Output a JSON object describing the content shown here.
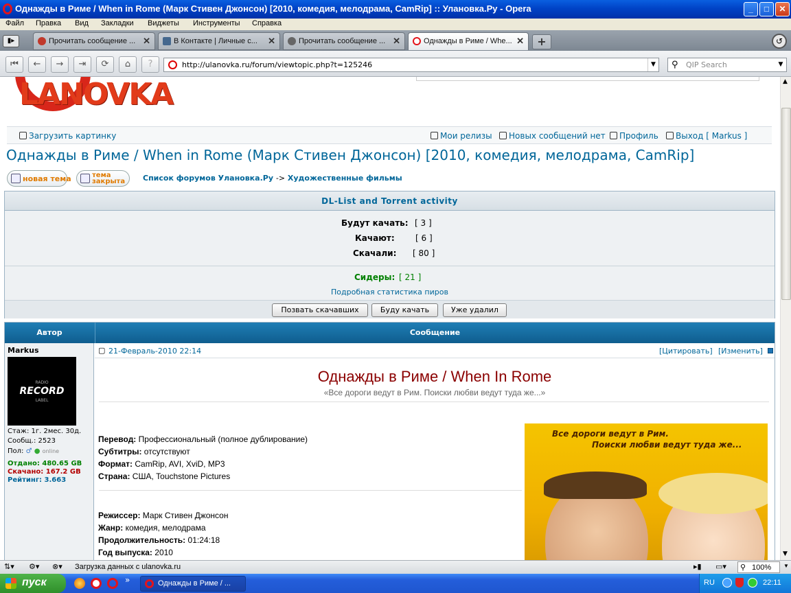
{
  "window": {
    "title": "Однажды в Риме / When in Rome (Марк Стивен Джонсон) [2010, комедия, мелодрама, CamRip] :: Улановка.Ру - Opera",
    "buttons": {
      "minimize": "_",
      "maximize": "□",
      "close": "✕"
    }
  },
  "menu": [
    "Файл",
    "Правка",
    "Вид",
    "Закладки",
    "Виджеты",
    "Инструменты",
    "Справка"
  ],
  "tabs": [
    {
      "label": "Прочитать сообщение ...",
      "favicon_color": "#c0392b"
    },
    {
      "label": "В Контакте | Личные с...",
      "favicon_color": "#45688e"
    },
    {
      "label": "Прочитать сообщение ...",
      "favicon_color": "#666666"
    },
    {
      "label": "Однажды в Риме / Whe...",
      "favicon_color": "#e3141b",
      "active": true
    }
  ],
  "nav": {
    "url": "http://ulanovka.ru/forum/viewtopic.php?t=125246",
    "search_placeholder": "QIP Search"
  },
  "site": {
    "logo": "LANOVKA",
    "toplinks": {
      "upload": "Загрузить картинку",
      "releases": "Мои релизы",
      "new_msgs": "Новых сообщений нет",
      "profile": "Профиль",
      "logout": "Выход [ Markus ]"
    },
    "topic_title": "Однажды в Риме / When in Rome (Марк Стивен Джонсон) [2010, комедия, мелодрама, CamRip]",
    "new_topic": "новая тема",
    "topic_closed": "тема закрыта",
    "breadcrumb": {
      "forums": "Список форумов Улановка.Ру",
      "sep": "->",
      "section": "Художественные фильмы"
    }
  },
  "dl": {
    "header": "DL-List and Torrent activity",
    "will_download_label": "Будут качать:",
    "will_download": "[ 3 ]",
    "downloading_label": "Качают:",
    "downloading": "[ 6 ]",
    "downloaded_label": "Скачали:",
    "downloaded": "[ 80 ]",
    "seeders_label": "Сидеры:",
    "seeders": "[ 21 ]",
    "peer_stats": "Подробная статистика пиров",
    "btn_call": "Позвать скачавших",
    "btn_will": "Буду качать",
    "btn_deleted": "Уже удалил"
  },
  "post": {
    "col_author": "Автор",
    "col_message": "Сообщение",
    "author": {
      "name": "Markus",
      "avatar_text": "RECORD",
      "avatar_small_top": "RADIO",
      "avatar_small_bottom": "LABEL",
      "tenure": "Стаж: 1г. 2мес. 30д.",
      "posts": "Сообщ.: 2523",
      "gender": "Пол:",
      "status": "online",
      "uploaded": "Отдано: 480.65 GB",
      "downloaded": "Скачано: 167.2 GB",
      "rating": "Рейтинг: 3.663"
    },
    "date": "21-Февраль-2010 22:14",
    "quote": "[Цитировать]",
    "edit": "[Изменить]",
    "heading": "Однажды в Риме / When In Rome",
    "tagline": "«Все дороги ведут в Рим. Поиски любви ведут туда же...»",
    "details": [
      {
        "label": "Перевод:",
        "value": " Профессиональный (полное дублирование)"
      },
      {
        "label": "Субтитры:",
        "value": " отсутствуют"
      },
      {
        "label": "Формат:",
        "value": " CamRip, AVI, XviD, MP3"
      },
      {
        "label": "Страна:",
        "value": " США, Touchstone Pictures"
      }
    ],
    "details2": [
      {
        "label": "Режиссер:",
        "value": " Марк Стивен Джонсон"
      },
      {
        "label": "Жанр:",
        "value": " комедия, мелодрама"
      },
      {
        "label": "Продолжительность:",
        "value": " 01:24:18"
      },
      {
        "label": "Год выпуска:",
        "value": " 2010"
      }
    ],
    "poster_line1": "Все дороги ведут в Рим.",
    "poster_line2": "Поиски любви ведут туда же..."
  },
  "status": {
    "text": "Загрузка данных с ulanovka.ru",
    "zoom": "100%"
  },
  "taskbar": {
    "start": "пуск",
    "task": "Однажды в Риме / ...",
    "lang": "RU",
    "time": "22:11"
  }
}
